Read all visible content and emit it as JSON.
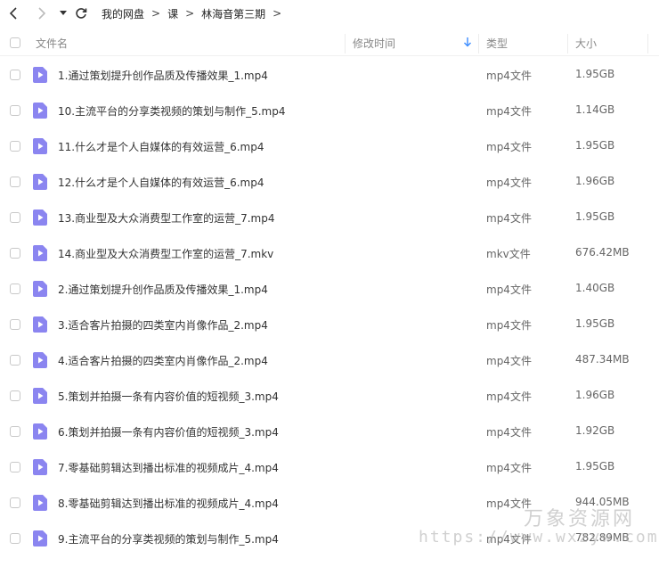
{
  "breadcrumb": {
    "items": [
      "我的网盘",
      "课",
      "林海音第三期"
    ],
    "separator": ">"
  },
  "columns": {
    "name": "文件名",
    "modified": "修改时间",
    "type": "类型",
    "size": "大小"
  },
  "files": [
    {
      "name": "1.通过策划提升创作品质及传播效果_1.mp4",
      "type": "mp4文件",
      "size": "1.95GB"
    },
    {
      "name": "10.主流平台的分享类视频的策划与制作_5.mp4",
      "type": "mp4文件",
      "size": "1.14GB"
    },
    {
      "name": "11.什么才是个人自媒体的有效运营_6.mp4",
      "type": "mp4文件",
      "size": "1.95GB"
    },
    {
      "name": "12.什么才是个人自媒体的有效运营_6.mp4",
      "type": "mp4文件",
      "size": "1.96GB"
    },
    {
      "name": "13.商业型及大众消费型工作室的运营_7.mp4",
      "type": "mp4文件",
      "size": "1.95GB"
    },
    {
      "name": "14.商业型及大众消费型工作室的运营_7.mkv",
      "type": "mkv文件",
      "size": "676.42MB"
    },
    {
      "name": "2.通过策划提升创作品质及传播效果_1.mp4",
      "type": "mp4文件",
      "size": "1.40GB"
    },
    {
      "name": "3.适合客片拍摄的四类室内肖像作品_2.mp4",
      "type": "mp4文件",
      "size": "1.95GB"
    },
    {
      "name": "4.适合客片拍摄的四类室内肖像作品_2.mp4",
      "type": "mp4文件",
      "size": "487.34MB"
    },
    {
      "name": "5.策划并拍摄一条有内容价值的短视频_3.mp4",
      "type": "mp4文件",
      "size": "1.96GB"
    },
    {
      "name": "6.策划并拍摄一条有内容价值的短视频_3.mp4",
      "type": "mp4文件",
      "size": "1.92GB"
    },
    {
      "name": "7.零基础剪辑达到播出标准的视频成片_4.mp4",
      "type": "mp4文件",
      "size": "1.95GB"
    },
    {
      "name": "8.零基础剪辑达到播出标准的视频成片_4.mp4",
      "type": "mp4文件",
      "size": "944.05MB"
    },
    {
      "name": "9.主流平台的分享类视频的策划与制作_5.mp4",
      "type": "mp4文件",
      "size": "782.89MB"
    }
  ],
  "watermark": {
    "text": "万象资源网",
    "url": "https://www.wxzyw.com"
  },
  "colors": {
    "file_icon": "#8b85f0",
    "sort_arrow": "#3b8cff",
    "header_text": "#888888"
  },
  "icons": {
    "back": "chevron-left-icon",
    "forward": "chevron-right-icon",
    "dropdown": "caret-down-icon",
    "refresh": "refresh-icon",
    "file": "video-file-icon",
    "sort": "sort-down-icon"
  }
}
